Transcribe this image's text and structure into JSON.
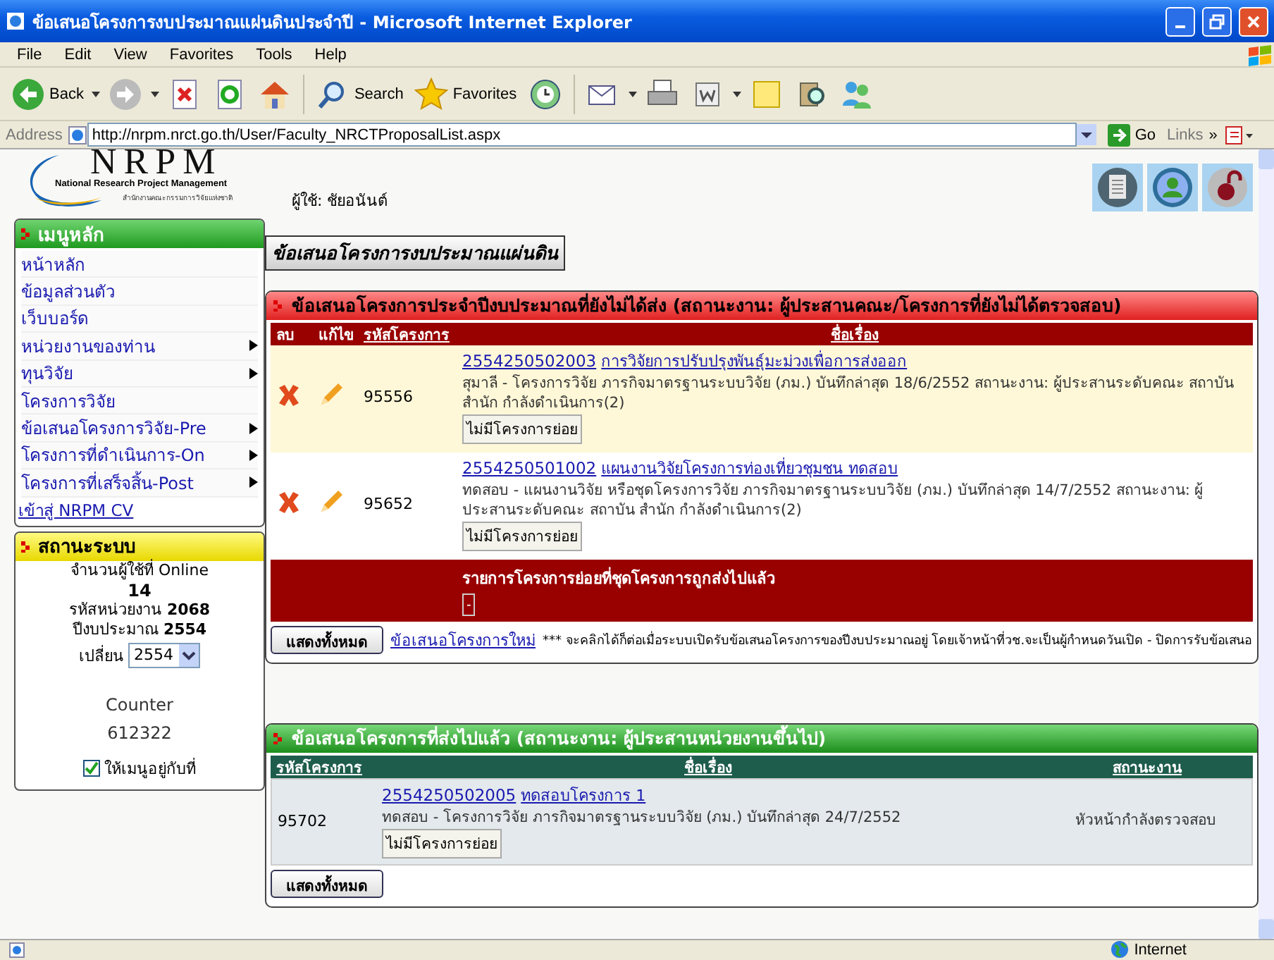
{
  "window": {
    "title": "ข้อเสนอโครงการงบประมาณแผ่นดินประจำปี - Microsoft Internet Explorer"
  },
  "menu_bar": [
    "File",
    "Edit",
    "View",
    "Favorites",
    "Tools",
    "Help"
  ],
  "toolbar": [
    {
      "kind": "back",
      "label": "Back"
    },
    {
      "kind": "forward"
    },
    {
      "kind": "stop"
    },
    {
      "kind": "refresh"
    },
    {
      "kind": "home"
    },
    {
      "kind": "search",
      "label": "Search"
    },
    {
      "kind": "favorites",
      "label": "Favorites"
    },
    {
      "kind": "history"
    },
    {
      "kind": "mail"
    },
    {
      "kind": "print"
    },
    {
      "kind": "edit"
    },
    {
      "kind": "note"
    },
    {
      "kind": "research"
    },
    {
      "kind": "messenger"
    }
  ],
  "address_bar": {
    "label": "Address",
    "value": "http://nrpm.nrct.go.th/User/Faculty_NRCTProposalList.aspx",
    "go": "Go",
    "links": "Links",
    "more": "»"
  },
  "header": {
    "logo": "NRPM",
    "logo_subtitle": "National Research Project Management",
    "logo_thai": "สำนักงานคณะกรรมการวิจัยแห่งชาติ",
    "user": "ผู้ใช้: ชัยอนันต์"
  },
  "main_menu": {
    "title": "เมนูหลัก",
    "items": [
      {
        "label": "หน้าหลัก",
        "has_submenu": false
      },
      {
        "label": "ข้อมูลส่วนตัว",
        "has_submenu": false
      },
      {
        "label": "เว็บบอร์ด",
        "has_submenu": false
      },
      {
        "label": "หน่วยงานของท่าน",
        "has_submenu": true
      },
      {
        "label": "ทุนวิจัย",
        "has_submenu": true
      },
      {
        "label": "โครงการวิจัย",
        "has_submenu": false
      },
      {
        "label": "ข้อเสนอโครงการวิจัย-Pre",
        "has_submenu": true
      },
      {
        "label": "โครงการที่ดำเนินการ-On",
        "has_submenu": true
      },
      {
        "label": "โครงการที่เสร็จสิ้น-Post",
        "has_submenu": true
      }
    ],
    "cv_link": "เข้าสู่ NRPM CV"
  },
  "system_status": {
    "title": "สถานะระบบ",
    "online_label": "จำนวนผู้ใช้ที่ Online",
    "online_count": "14",
    "unit": "รหัสหน่วยงาน **2068**",
    "budget_year": "ปีงบประมาณ **2554**",
    "change_label": "เปลี่ยน",
    "year_select": "2554",
    "counter_label": "Counter",
    "counter": "612322",
    "pin_menu": {
      "label": "ให้เมนูอยู่กับที่",
      "checked": true
    }
  },
  "page_title": "ข้อเสนอโครงการงบประมาณแผ่นดิน",
  "pending_panel": {
    "title": "ข้อเสนอโครงการประจำปีงบประมาณที่ยังไม่ได้ส่ง (สถานะงาน: ผู้ประสานคณะ/โครงการที่ยังไม่ได้ตรวจสอบ)",
    "columns": [
      "ลบ",
      "แก้ไข",
      "รหัสโครงการ",
      "ชื่อเรื่อง"
    ],
    "rows": [
      {
        "id": "95556",
        "code": "2554250502003",
        "title": "การวิจัยการปรับปรุงพันธุ์มะม่วงเพื่อการส่งออก",
        "detail": "สุมาลี - โครงการวิจัย ภารกิจมาตรฐานระบบวิจัย (ภม.) บันทึกล่าสุด 18/6/2552 สถานะงาน: ผู้ประสานระดับคณะ สถาบัน สำนัก กำลังดำเนินการ(2)",
        "sub_button": "ไม่มีโครงการย่อย"
      },
      {
        "id": "95652",
        "code": "2554250501002",
        "title": "แผนงานวิจัยโครงการท่องเที่ยวชุมชน ทดสอบ",
        "detail": "ทดสอบ - แผนงานวิจัย หรือชุดโครงการวิจัย ภารกิจมาตรฐานระบบวิจัย (ภม.) บันทึกล่าสุด 14/7/2552 สถานะงาน: ผู้ประสานระดับคณะ สถาบัน สำนัก กำลังดำเนินการ(2)",
        "sub_button": "ไม่มีโครงการย่อย"
      }
    ],
    "sub_header": "รายการโครงการย่อยที่ชุดโครงการถูกส่งไปแล้ว",
    "collapse": "-",
    "show_all": "แสดงทั้งหมด",
    "new_link": "ข้อเสนอโครงการใหม่",
    "note": "*** จะคลิกได้ก็ต่อเมื่อระบบเปิดรับข้อเสนอโครงการของปีงบประมาณอยู่ โดยเจ้าหน้าที่วช.จะเป็นผู้กำหนดวันเปิด - ปิดการรับข้อเสนอ"
  },
  "sent_panel": {
    "title": "ข้อเสนอโครงการที่ส่งไปแล้ว (สถานะงาน: ผู้ประสานหน่วยงานขึ้นไป)",
    "columns": [
      "รหัสโครงการ",
      "ชื่อเรื่อง",
      "สถานะงาน"
    ],
    "rows": [
      {
        "id": "95702",
        "code": "2554250502005",
        "title": "ทดสอบโครงการ 1",
        "detail": "ทดสอบ - โครงการวิจัย ภารกิจมาตรฐานระบบวิจัย (ภม.) บันทึกล่าสุด 24/7/2552",
        "sub_button": "ไม่มีโครงการย่อย",
        "status": "หัวหน้ากำลังตรวจสอบ"
      }
    ],
    "show_all": "แสดงทั้งหมด"
  },
  "status_bar": {
    "zone": "Internet"
  }
}
